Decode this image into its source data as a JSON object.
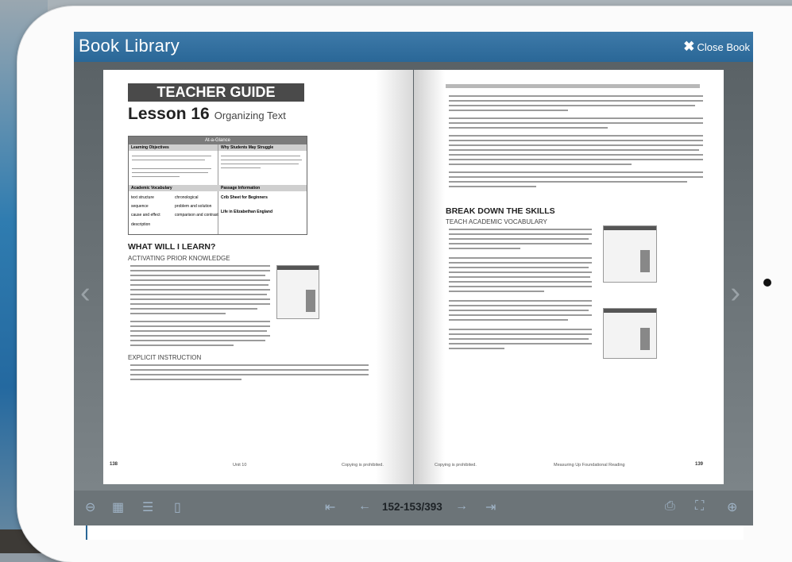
{
  "app": {
    "title": "Book Library",
    "close_label": "Close Book"
  },
  "toolbar": {
    "page_indicator": "152-153/393",
    "icons": [
      "zoom-out-icon",
      "thumbnails-icon",
      "list-icon",
      "bookmark-icon",
      "first-page-icon",
      "previous-page-icon",
      "next-page-icon",
      "last-page-icon",
      "print-icon",
      "fullscreen-icon",
      "zoom-in-icon"
    ]
  },
  "left_page": {
    "banner": "TEACHER GUIDE",
    "lesson": "Lesson 16",
    "lesson_subtitle": "Organizing Text",
    "glance_title": "At-a-Glance",
    "glance_objectives": "Learning Objectives",
    "glance_why": "Why Students May Struggle",
    "glance_vocab": "Academic Vocabulary",
    "glance_passage": "Passage Information",
    "vocab_words": [
      "text structure",
      "chronological",
      "sequence",
      "problem and solution",
      "cause and effect",
      "comparison and contrast",
      "description"
    ],
    "passage_1": "Crib Sheet for Beginners",
    "passage_2": "Life in Elizabethan England",
    "section_heading": "WHAT WILL I LEARN?",
    "sub_heading_1": "ACTIVATING PRIOR KNOWLEDGE",
    "sub_heading_2": "EXPLICIT INSTRUCTION",
    "page_number": "138",
    "footer_center": "Unit 10",
    "footer_right": "Copying is prohibited."
  },
  "right_page": {
    "section_heading": "BREAK DOWN THE SKILLS",
    "sub_heading": "TEACH ACADEMIC VOCABULARY",
    "page_number": "139",
    "footer_left": "Copying is prohibited.",
    "footer_center": "Measuring Up Foundational Reading"
  },
  "colors": {
    "topbar": "#2f6d9c",
    "viewer_bg": "#6c7478",
    "page_indicator_text": "#1d2226"
  }
}
